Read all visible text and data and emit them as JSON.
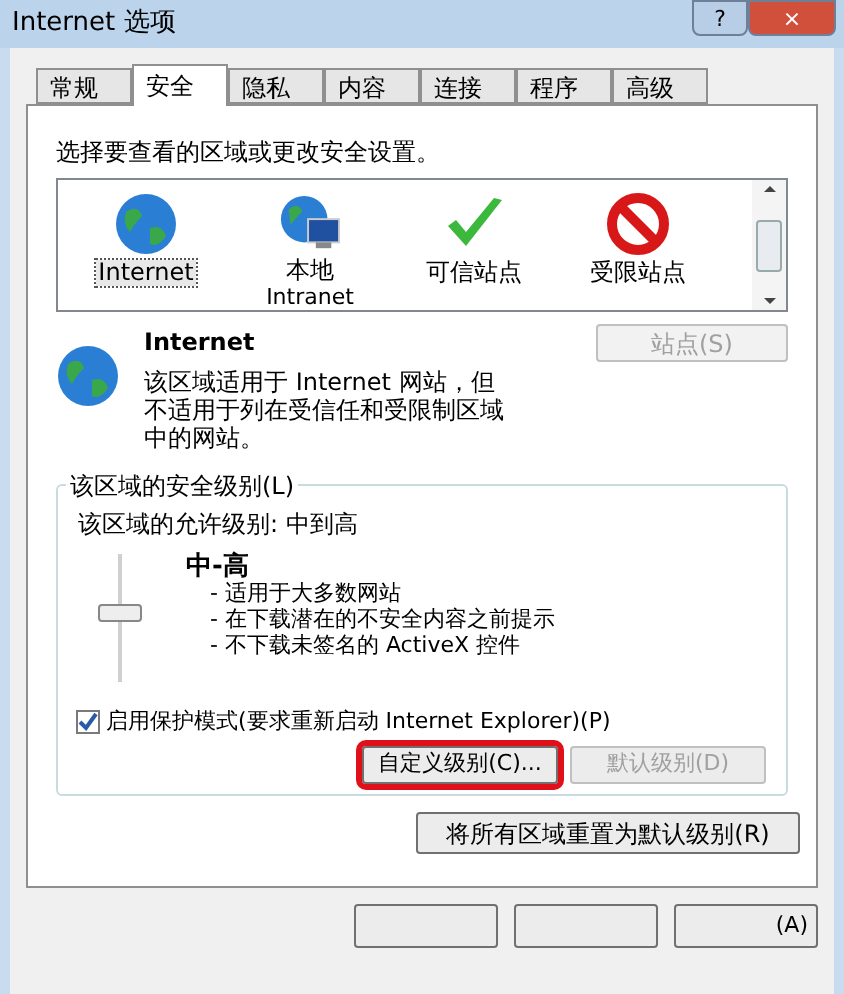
{
  "window": {
    "title": "Internet 选项",
    "controls": [
      "?",
      "×"
    ]
  },
  "tabs": [
    {
      "label": "常规",
      "selected": false
    },
    {
      "label": "安全",
      "selected": true
    },
    {
      "label": "隐私",
      "selected": false
    },
    {
      "label": "内容",
      "selected": false
    },
    {
      "label": "连接",
      "selected": false
    },
    {
      "label": "程序",
      "selected": false
    },
    {
      "label": "高级",
      "selected": false
    }
  ],
  "zone_prompt": "选择要查看的区域或更改安全设置。",
  "zones": [
    {
      "kind": "globe",
      "label": "Internet",
      "selected": true
    },
    {
      "kind": "intranet",
      "label": "本地",
      "sublabel": "Intranet",
      "selected": false
    },
    {
      "kind": "check",
      "label": "可信站点",
      "selected": false
    },
    {
      "kind": "blocked",
      "label": "受限站点",
      "selected": false
    }
  ],
  "zone_detail": {
    "title": "Internet",
    "description": "该区域适用于 Internet 网站，但不适用于列在受信任和受限制区域中的网站。",
    "sites_button": {
      "label": "站点(S)",
      "disabled": true
    }
  },
  "security_level": {
    "group_title": "该区域的安全级别(L)",
    "allowed": "该区域的允许级别: 中到高",
    "level": 0.55,
    "level_name": "中-高",
    "bullets": [
      "- 适用于大多数网站",
      "- 在下载潜在的不安全内容之前提示",
      "- 不下载未签名的 ActiveX 控件"
    ],
    "protected_mode": {
      "label": "启用保护模式(要求重新启动 Internet Explorer)(P)",
      "checked": true
    },
    "buttons": [
      {
        "label": "自定义级别(C)...",
        "disabled": false,
        "highlighted": true
      },
      {
        "label": "默认级别(D)",
        "disabled": true,
        "highlighted": false
      }
    ]
  },
  "reset_button": "将所有区域重置为默认级别(R)",
  "dialog_buttons": [
    {
      "kind": "covered"
    },
    {
      "kind": "covered"
    },
    {
      "kind": "labeled",
      "label": "(A)"
    }
  ]
}
